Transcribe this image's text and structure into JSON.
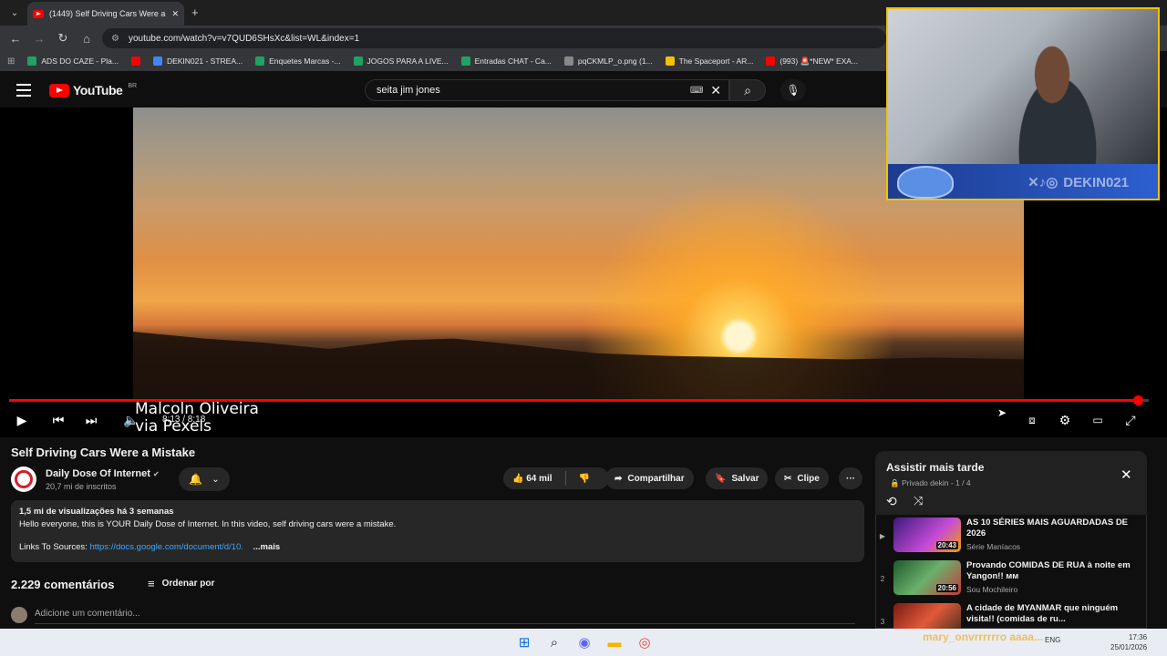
{
  "browser": {
    "tab_title": "(1449) Self Driving Cars Were a Mistake",
    "new_tab_glyph": "+",
    "close_glyph": "✕",
    "url": "youtube.com/watch?v=v7QUD6SHsXc&list=WL&index=1",
    "bookmarks": [
      {
        "label": "ADS DO CAZE - Pla...",
        "color": "#1ea362"
      },
      {
        "label": "",
        "color": "#ff0000"
      },
      {
        "label": "DEKIN021 - STREA...",
        "color": "#4285f4"
      },
      {
        "label": "Enquetes Marcas -...",
        "color": "#1ea362"
      },
      {
        "label": "JOGOS PARA A LIVE...",
        "color": "#1ea362"
      },
      {
        "label": "Entradas CHAT - Ca...",
        "color": "#1ea362"
      },
      {
        "label": "pqCKMLP_o.png (1...",
        "color": "#888888"
      },
      {
        "label": "The Spaceport - AR...",
        "color": "#f2c200"
      },
      {
        "label": "(993) 🚨*NEW* EXA...",
        "color": "#ff0000"
      }
    ]
  },
  "youtube": {
    "logo_text": "YouTube",
    "logo_region": "BR",
    "search_value": "seita jim jones",
    "video": {
      "overlay_credit_1": "Malcoln Oliveira",
      "overlay_credit_2": "via Pexels",
      "time": "8:13 / 8:18",
      "progress_fraction": 0.99
    },
    "title": "Self Driving Cars Were a Mistake",
    "channel": {
      "name": "Daily Dose Of Internet",
      "verified_glyph": "✔",
      "subscribers": "20,7 mi de inscritos"
    },
    "actions": {
      "likes": "64 mil",
      "share": "Compartilhar",
      "save": "Salvar",
      "clip": "Clipe",
      "more": "···"
    },
    "description": {
      "stats": "1,5 mi de visualizações  há 3 semanas",
      "text": "Hello everyone, this is YOUR Daily Dose of Internet. In this video, self driving cars were a mistake.",
      "links_label": "Links To Sources:",
      "link": "https://docs.google.com/document/d/10.",
      "more": "...mais"
    },
    "comments": {
      "count": "2.229 comentários",
      "sort": "Ordenar por",
      "placeholder": "Adicione um comentário..."
    }
  },
  "playlist": {
    "title": "Assistir mais tarde",
    "subtitle": "Privado dekin - 1 / 4",
    "items": [
      {
        "index": "▶",
        "title": "AS 10 SÉRIES MAIS AGUARDADAS DE 2026",
        "channel": "Série Maníacos",
        "duration": "20:43",
        "thumb": "#7d2bd1"
      },
      {
        "index": "2",
        "title": "Provando COMIDAS DE RUA à noite em Yangon!! ᴍᴍ",
        "channel": "Sou Mochileiro",
        "duration": "20:56",
        "thumb": "#2f7a3b"
      },
      {
        "index": "3",
        "title": "A cidade de MYANMAR que ninguém visita!! (comidas de ru...",
        "channel": "",
        "duration": "",
        "thumb": "#c0392b"
      }
    ]
  },
  "webcam": {
    "banner_text": "DEKIN021"
  },
  "taskbar": {
    "tray_text": "mary_onvrrrrrro   aaaa...",
    "lang": "ENG",
    "clock_time": "17:36",
    "clock_date": "25/01/2026"
  }
}
